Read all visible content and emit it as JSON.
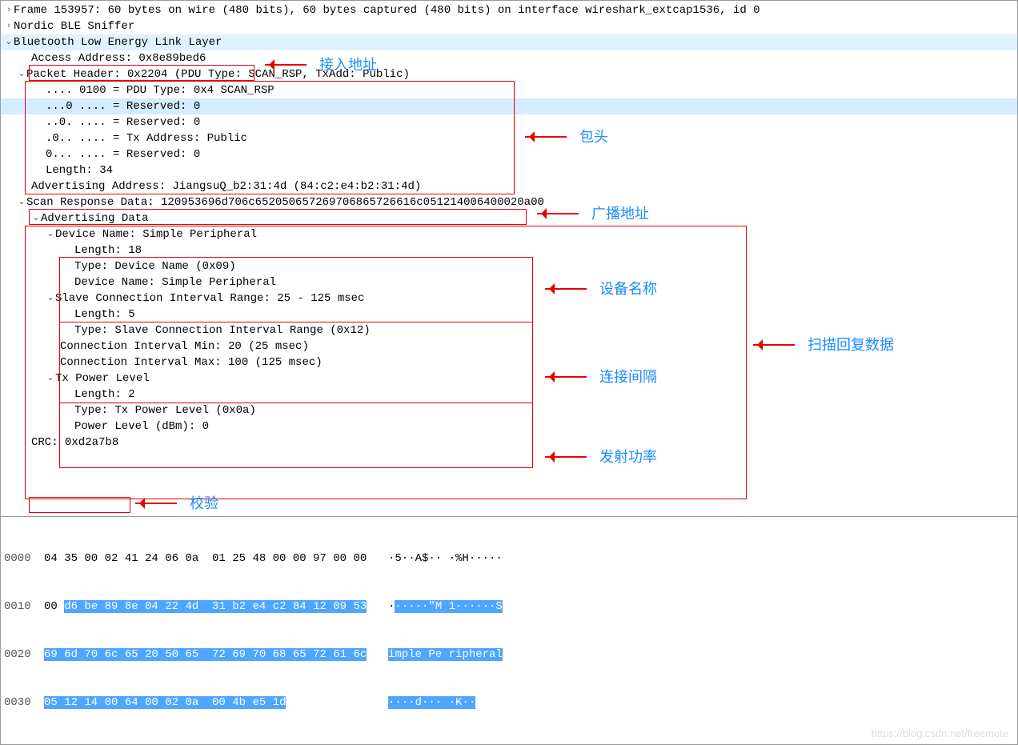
{
  "annotations": {
    "access_address": "接入地址",
    "packet_header": "包头",
    "adv_address": "广播地址",
    "device_name": "设备名称",
    "scan_response_data": "扫描回复数据",
    "conn_interval": "连接间隔",
    "tx_power": "发射功率",
    "crc": "校验"
  },
  "tree": {
    "frame": "Frame 153957: 60 bytes on wire (480 bits), 60 bytes captured (480 bits) on interface wireshark_extcap1536, id 0",
    "nordic": "Nordic BLE Sniffer",
    "ble_ll": "Bluetooth Low Energy Link Layer",
    "access_address": "Access Address: 0x8e89bed6",
    "packet_header": "Packet Header: 0x2204 (PDU Type: SCAN_RSP, TxAdd: Public)",
    "ph_pdu_type": ".... 0100 = PDU Type: 0x4 SCAN_RSP",
    "ph_reserved1": "...0 .... = Reserved: 0",
    "ph_reserved2": "..0. .... = Reserved: 0",
    "ph_txaddr": ".0.. .... = Tx Address: Public",
    "ph_reserved3": "0... .... = Reserved: 0",
    "ph_length": "Length: 34",
    "adv_address": "Advertising Address: JiangsuQ_b2:31:4d (84:c2:e4:b2:31:4d)",
    "scan_rsp_data": "Scan Response Data: 120953696d706c652050657269706865726616c051214006400020a00",
    "adv_data": "Advertising Data",
    "dev_name_hdr": "Device Name: Simple Peripheral",
    "dn_length": "Length: 18",
    "dn_type": "Type: Device Name (0x09)",
    "dn_value": "Device Name: Simple Peripheral",
    "slave_conn_hdr": "Slave Connection Interval Range: 25 - 125 msec",
    "sc_length": "Length: 5",
    "sc_type": "Type: Slave Connection Interval Range (0x12)",
    "sc_min": "Connection Interval Min: 20 (25 msec)",
    "sc_max": "Connection Interval Max: 100 (125 msec)",
    "tx_power_hdr": "Tx Power Level",
    "tp_length": "Length: 2",
    "tp_type": "Type: Tx Power Level (0x0a)",
    "tp_value": "Power Level (dBm): 0",
    "crc": "CRC: 0xd2a7b8"
  },
  "hex": {
    "r0": {
      "off": "0000",
      "b": "04 35 00 02 41 24 06 0a  01 25 48 00 00 97 00 00",
      "a": "·5··A$·· ·%H·····"
    },
    "r1": {
      "off": "0010",
      "b0": "00 ",
      "b1": "d6 be 89 8e 04 22 4d  31 b2 e4 c2 84 12 09 53",
      "a0": "·",
      "a1": "·····\"M 1······S"
    },
    "r2": {
      "off": "0020",
      "b": "69 6d 70 6c 65 20 50 65  72 69 70 68 65 72 61 6c",
      "a": "imple Pe ripheral"
    },
    "r3": {
      "off": "0030",
      "b": "05 12 14 00 64 00 02 0a  00 4b e5 1d",
      "a": "····d··· ·K··"
    }
  },
  "watermark": "https://blog.csdn.net/freemote"
}
